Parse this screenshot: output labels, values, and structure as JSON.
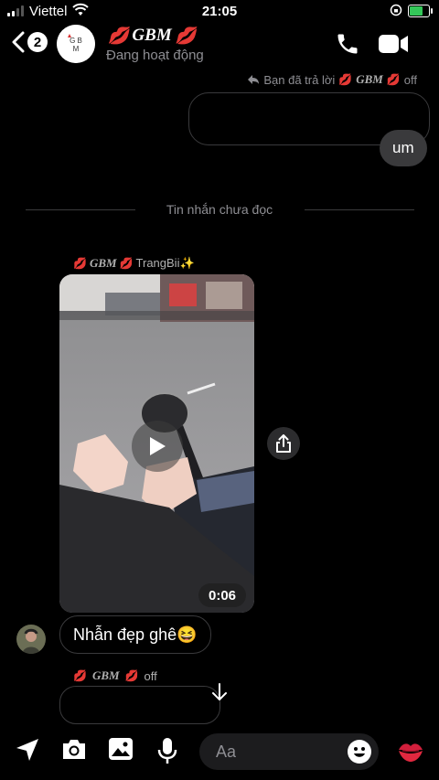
{
  "status_bar": {
    "carrier": "Viettel",
    "time": "21:05"
  },
  "header": {
    "back_count": "2",
    "title": "GBM",
    "subtitle": "Đang hoạt động"
  },
  "reply_label": {
    "text": "Bạn đã trả lời",
    "name": "GBM",
    "suffix": "off"
  },
  "messages": {
    "my_reply": "um",
    "divider": "Tin nhắn chưa đọc",
    "sender_name": "GBM",
    "sender_suffix": "TrangBii✨",
    "video_duration": "0:06",
    "text_message": "Nhẫn đẹp ghê😆",
    "sender2_name": "GBM",
    "sender2_suffix": "off"
  },
  "composer": {
    "placeholder": "Aa"
  }
}
